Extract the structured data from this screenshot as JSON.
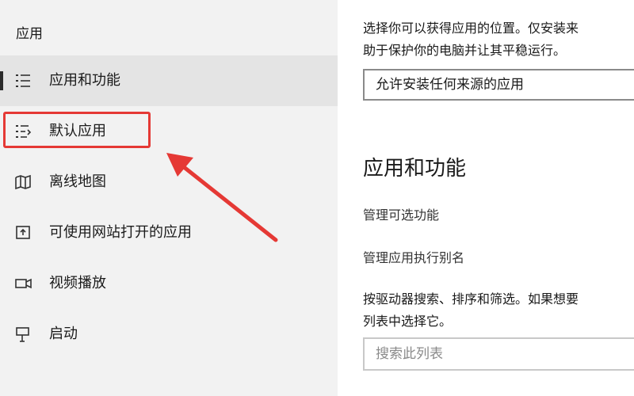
{
  "sidebar": {
    "section_title": "应用",
    "items": [
      {
        "label": "应用和功能",
        "icon": "apps-features-icon",
        "selected": true
      },
      {
        "label": "默认应用",
        "icon": "default-apps-icon",
        "selected": false
      },
      {
        "label": "离线地图",
        "icon": "offline-maps-icon",
        "selected": false
      },
      {
        "label": "可使用网站打开的应用",
        "icon": "apps-for-websites-icon",
        "selected": false
      },
      {
        "label": "视频播放",
        "icon": "video-playback-icon",
        "selected": false
      },
      {
        "label": "启动",
        "icon": "startup-icon",
        "selected": false
      }
    ]
  },
  "annotation": {
    "highlight_color": "#e53935"
  },
  "main": {
    "description_line1": "选择你可以获得应用的位置。仅安装来",
    "description_line2": "助于保护你的电脑并让其平稳运行。",
    "install_source_value": "允许安装任何来源的应用",
    "section_heading": "应用和功能",
    "link_optional_features": "管理可选功能",
    "link_execution_alias": "管理应用执行别名",
    "filter_line1": "按驱动器搜索、排序和筛选。如果想要",
    "filter_line2": "列表中选择它。",
    "search_placeholder": "搜索此列表"
  }
}
